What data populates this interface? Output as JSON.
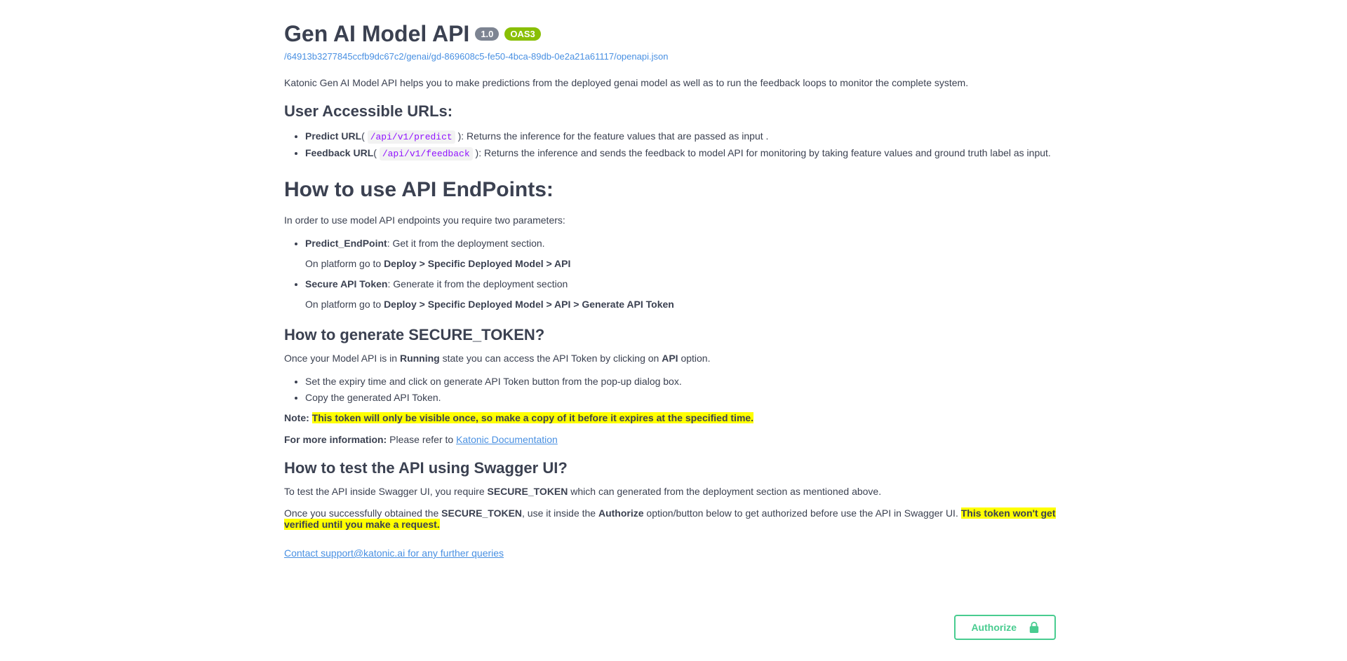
{
  "header": {
    "title": "Gen AI Model API",
    "version": "1.0",
    "oas_label": "OAS3",
    "spec_url": "/64913b3277845ccfb9dc67c2/genai/gd-869608c5-fe50-4bca-89db-0e2a21a61117/openapi.json"
  },
  "intro": "Katonic Gen AI Model API helps you to make predictions from the deployed genai model as well as to run the feedback loops to monitor the complete system.",
  "urls_heading": "User Accessible URLs:",
  "urls": {
    "predict": {
      "label_bold": "Predict URL",
      "path": "/api/v1/predict",
      "desc": "): Returns the inference for the feature values that are passed as input ."
    },
    "feedback": {
      "label_bold": "Feedback URL",
      "path": "/api/v1/feedback",
      "desc": "): Returns the inference and sends the feedback to model API for monitoring by taking feature values and ground truth label as input."
    }
  },
  "how_use_heading": "How to use API EndPoints:",
  "how_use_intro": "In order to use model API endpoints you require two parameters:",
  "params": {
    "predict_ep": {
      "bold": "Predict_EndPoint",
      "tail": ": Get it from the deployment section.",
      "nav_prefix": "On platform go to ",
      "nav_bold": "Deploy > Specific Deployed Model > API"
    },
    "token": {
      "bold": "Secure API Token",
      "tail": ": Generate it from the deployment section",
      "nav_prefix": "On platform go to ",
      "nav_bold": "Deploy > Specific Deployed Model > API > Generate API Token"
    }
  },
  "gen_token_heading": "How to generate SECURE_TOKEN?",
  "gen_token_sentence": {
    "pre": "Once your Model API is in ",
    "bold1": "Running",
    "mid": " state you can access the API Token by clicking on ",
    "bold2": "API",
    "post": " option."
  },
  "gen_steps": [
    "Set the expiry time and click on generate API Token button from the pop-up dialog box.",
    "Copy the generated API Token."
  ],
  "note": {
    "label": "Note: ",
    "highlight": "This token will only be visible once, so make a copy of it before it expires at the specified time."
  },
  "more_info": {
    "label": "For more information: ",
    "plain": "Please refer to ",
    "link_text": "Katonic Documentation"
  },
  "swagger_heading": "How to test the API using Swagger UI?",
  "swagger_p1": {
    "pre": "To test the API inside Swagger UI, you require ",
    "bold": "SECURE_TOKEN",
    "post": " which can generated from the deployment section as mentioned above."
  },
  "swagger_p2": {
    "pre": "Once you successfully obtained the ",
    "bold1": "SECURE_TOKEN",
    "mid1": ", use it inside the ",
    "bold2": "Authorize",
    "mid2": " option/button below to get authorized before use the API in Swagger UI. ",
    "highlight": "This token won't get verified until you make a request."
  },
  "contact": "Contact support@katonic.ai for any further queries",
  "authorize_label": "Authorize"
}
